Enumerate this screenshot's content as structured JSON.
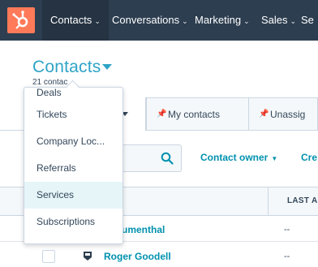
{
  "topnav": {
    "items": [
      {
        "label": "Contacts",
        "active": true
      },
      {
        "label": "Conversations"
      },
      {
        "label": "Marketing"
      },
      {
        "label": "Sales"
      },
      {
        "label": "Se"
      }
    ],
    "chevron": "⌄"
  },
  "header": {
    "title": "Contacts",
    "count": "21 contac"
  },
  "tabs": [
    {
      "label": "My contacts"
    },
    {
      "label": "Unassig"
    }
  ],
  "filters": {
    "contact_owner": "Contact owner",
    "dropdown_glyph": "▼",
    "next_partial": "Cre"
  },
  "table": {
    "last_column": "LAST AC",
    "rows": [
      {
        "name": "e Blumenthal",
        "last": "--"
      },
      {
        "name": "Roger Goodell",
        "last": "--"
      }
    ]
  },
  "dropdown": {
    "items": [
      {
        "label": "Deals"
      },
      {
        "label": "Tickets"
      },
      {
        "label": "Company Loc..."
      },
      {
        "label": "Referrals"
      },
      {
        "label": "Services",
        "hover": true
      },
      {
        "label": "Subscriptions"
      }
    ]
  },
  "colors": {
    "nav_bg": "#2d3e50",
    "brand_orange": "#ff7a59",
    "link": "#0091ae",
    "title": "#2fa4c7",
    "hover_bg": "#e5f5f8"
  }
}
